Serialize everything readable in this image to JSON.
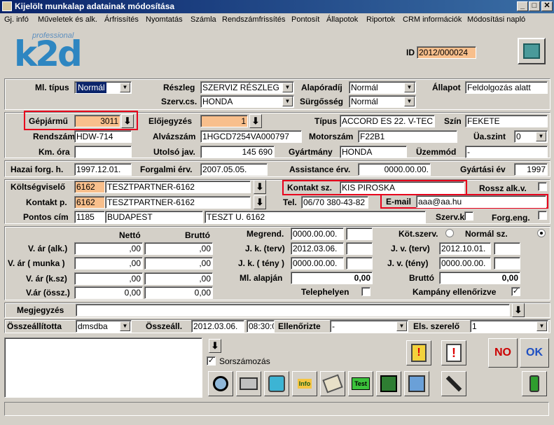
{
  "window": {
    "title": "Kijelölt munkalap adatainak módosítása",
    "min": "_",
    "max": "□",
    "close": "✕"
  },
  "menu": [
    "Gj. infó",
    "Műveletek és alk.",
    "Árfrissítés",
    "Nyomtatás",
    "Számla",
    "Rendszámfrissítés",
    "Pontosít",
    "Állapotok",
    "Riportok",
    "CRM információk",
    "Módosítási napló"
  ],
  "logo": {
    "word": "k2d",
    "tag": "professional"
  },
  "id": {
    "label": "ID",
    "value": "2012/000024"
  },
  "row1": {
    "ml_tipus_label": "Ml. típus",
    "ml_tipus": "Normál",
    "reszleg_label": "Részleg",
    "reszleg": "SZERVIZ RÉSZLEG",
    "szervcs_label": "Szerv.cs.",
    "szervcs": "HONDA",
    "aloporadij_label": "Alapóradíj",
    "aloporadij": "Normál",
    "surgosseg_label": "Sürgősség",
    "surgosseg": "Normál",
    "allapot_label": "Állapot",
    "allapot": "Feldolgozás alatt"
  },
  "vehicle": {
    "gepjarmu_label": "Gépjármű",
    "gepjarmu": "3011",
    "elojegyzes_label": "Előjegyzés",
    "elojegyzes": "1",
    "tipus_label": "Típus",
    "tipus": "ACCORD ES 22. V-TEC",
    "szin_label": "Szín",
    "szin": "FEKETE",
    "rendszam_label": "Rendszám",
    "rendszam": "HDW-714",
    "alvazszam_label": "Alvázszám",
    "alvazszam": "1HGCD7254VA000797",
    "motorszam_label": "Motorszám",
    "motorszam": "F22B1",
    "uaszint_label": "Üa.szint",
    "uaszint": "0",
    "kmora_label": "Km. óra",
    "kmora": "",
    "utolsojav_label": "Utolsó jav.",
    "utolsojav": "145 690",
    "gyartmany_label": "Gyártmány",
    "gyartmany": "HONDA",
    "uzemmod_label": "Üzemmód",
    "uzemmod": "-"
  },
  "dates": {
    "hazai_label": "Hazai forg. h.",
    "hazai": "1997.12.01.",
    "forgalmi_label": "Forgalmi érv.",
    "forgalmi": "2007.05.05.",
    "assistance_label": "Assistance érv.",
    "assistance": "0000.00.00.",
    "gyartasi_label": "Gyártási év",
    "gyartasi": "1997"
  },
  "partner": {
    "koltseg_label": "Költségviselő",
    "koltseg_id": "6162",
    "koltseg_name": "TESZTPARTNER-6162",
    "kontaktsz_label": "Kontakt sz.",
    "kontaktsz": "KIS PIROSKA",
    "rosszalk_label": "Rossz alk.v.",
    "kontaktp_label": "Kontakt p.",
    "kontaktp_id": "6162",
    "kontaktp_name": "TESZTPARTNER-6162",
    "tel_label": "Tel.",
    "tel": "06/70 380-43-82",
    "email_label": "E-mail",
    "email": "aaa@aa.hu",
    "cim_label": "Pontos cím",
    "cim_zip": "1185",
    "cim_city": "BUDAPEST",
    "cim_street": "TESZT U. 6162",
    "szervk_label": "Szerv.k.",
    "forgeng_label": "Forg.eng."
  },
  "prices": {
    "netto_h": "Nettó",
    "brutto_h": "Bruttó",
    "rows": [
      {
        "label": "V. ár (alk.)",
        "netto": ",00",
        "brutto": ",00"
      },
      {
        "label": "V. ár ( munka )",
        "netto": ",00",
        "brutto": ",00"
      },
      {
        "label": "V. ár (k.sz)",
        "netto": ",00",
        "brutto": ",00"
      },
      {
        "label": "V.ár (össz.)",
        "netto": "0,00",
        "brutto": "0,00"
      }
    ]
  },
  "schedule": {
    "megrend_label": "Megrend.",
    "megrend": "0000.00.00.",
    "jk_terv_label": "J. k. (terv)",
    "jk_terv": "2012.03.06.",
    "jk_teny_label": "J. k. ( tény )",
    "jk_teny": "0000.00.00.",
    "ml_alapjan_label": "Ml. alapján",
    "ml_alapjan": "0,00",
    "telephelyen_label": "Telephelyen",
    "kotszerv_label": "Köt.szerv.",
    "normalsz_label": "Normál sz.",
    "jv_terv_label": "J. v. (terv)",
    "jv_terv": "2012.10.01.",
    "jv_teny_label": "J. v. (tény)",
    "jv_teny": "0000.00.00.",
    "brutto_label": "Bruttó",
    "brutto": "0,00",
    "kampany_label": "Kampány ellenőrizve"
  },
  "megjegyzes": {
    "label": "Megjegyzés",
    "value": ""
  },
  "bottom": {
    "osszeall_label": "Összeállította",
    "osszeall": "dmsdba",
    "osszeall_date_label": "Összeáll.",
    "osszeall_date": "2012.03.06.",
    "osszeall_time": "08:30:0",
    "ellenorizte_label": "Ellenőrizte",
    "ellenorizte": "-",
    "elsszerelo_label": "Els. szerelő",
    "elsszerelo": "1"
  },
  "toolbar": {
    "sorszam_label": "Sorszámozás",
    "info": "Info",
    "test": "Test",
    "no": "NO",
    "ok": "OK"
  },
  "colors": {
    "titlebar": "#0a246a",
    "orange_field": "#f8bf8c",
    "highlight": "#e8001c",
    "logo_blue": "#2e86c1"
  }
}
